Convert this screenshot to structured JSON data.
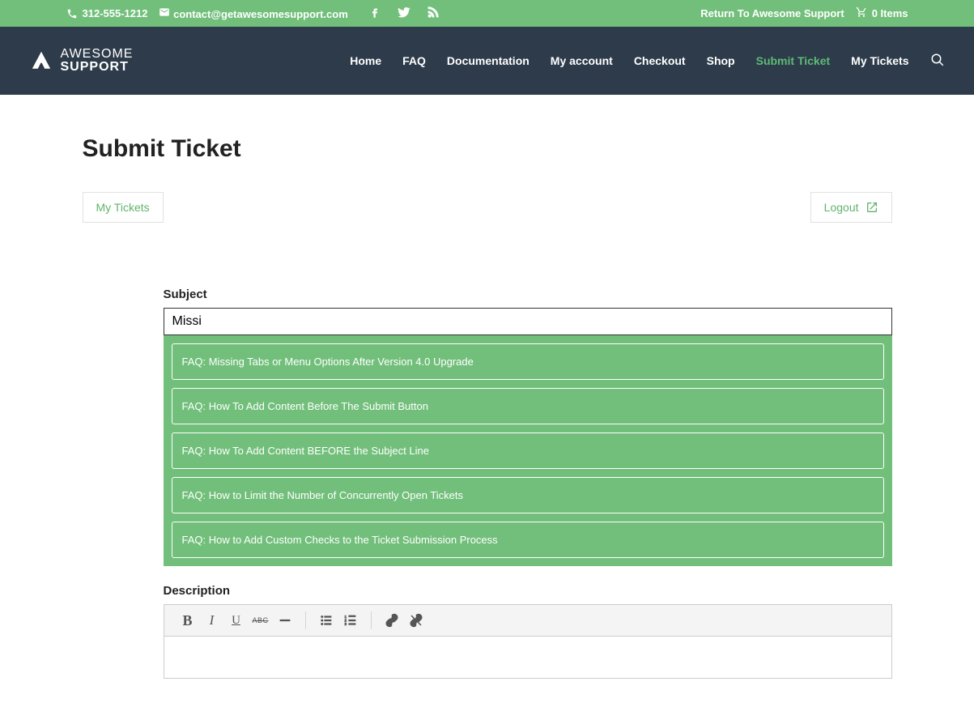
{
  "topbar": {
    "phone": "312-555-1212",
    "email": "contact@getawesomesupport.com",
    "return_link": "Return To Awesome Support",
    "cart_items": "0 Items"
  },
  "logo": {
    "line1": "AWESOME",
    "line2": "SUPPORT"
  },
  "nav": {
    "home": "Home",
    "faq": "FAQ",
    "docs": "Documentation",
    "account": "My account",
    "checkout": "Checkout",
    "shop": "Shop",
    "submit": "Submit Ticket",
    "mytickets": "My Tickets"
  },
  "page": {
    "title": "Submit Ticket",
    "my_tickets_btn": "My Tickets",
    "logout_btn": "Logout"
  },
  "form": {
    "subject_label": "Subject",
    "subject_value": "Missi",
    "description_label": "Description"
  },
  "suggestions": [
    "FAQ: Missing Tabs or Menu Options After Version 4.0 Upgrade",
    "FAQ: How To Add Content Before The Submit Button",
    "FAQ: How To Add Content BEFORE the Subject Line",
    "FAQ: How to Limit the Number of Concurrently Open Tickets",
    "FAQ: How to Add Custom Checks to the Ticket Submission Process"
  ]
}
